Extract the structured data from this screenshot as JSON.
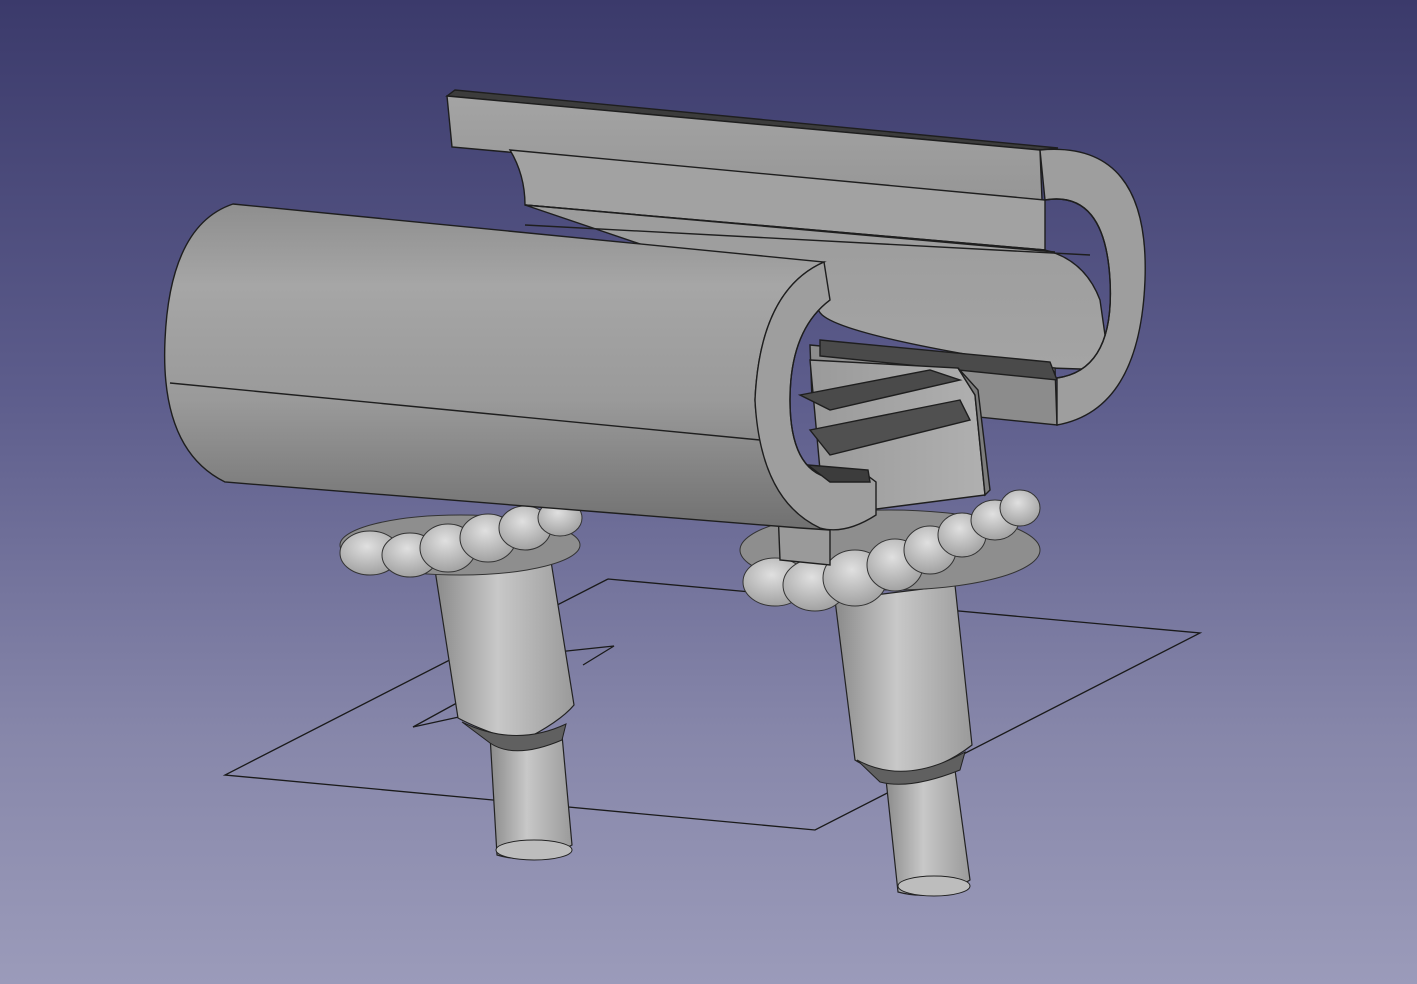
{
  "viewport": {
    "background_top": "#3b3a6b",
    "background_bottom": "#9b9bba"
  },
  "model": {
    "body_color": "#9a9a9a",
    "edge_color": "#1a1a1a",
    "components": [
      {
        "name": "front-half-pipe-clip"
      },
      {
        "name": "rear-half-pipe-clip"
      },
      {
        "name": "center-connector-block"
      },
      {
        "name": "left-push-pin"
      },
      {
        "name": "right-push-pin"
      }
    ]
  },
  "sketch": {
    "line_color": "#1a1a1a"
  }
}
